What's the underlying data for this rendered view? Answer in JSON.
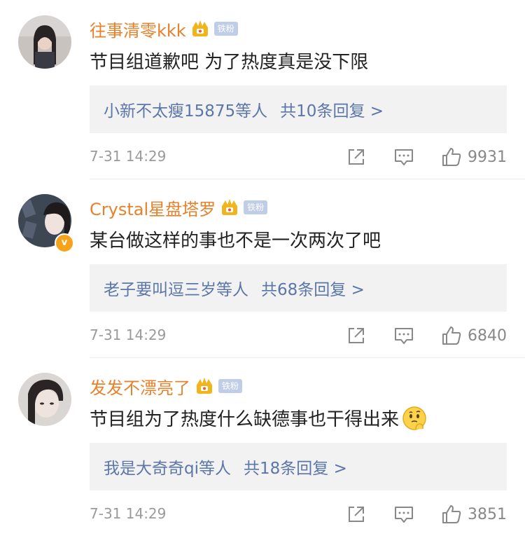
{
  "comments": [
    {
      "username": "往事清零kkk",
      "badge": "铁粉",
      "text": "节目组道歉吧 为了热度真是没下限",
      "reply_user": "小新不太瘦15875",
      "reply_suffix": "等人",
      "reply_count": "共10条回复 >",
      "time": "7-31 14:29",
      "likes": "9931",
      "verified": false
    },
    {
      "username": "Crystal星盘塔罗",
      "badge": "铁粉",
      "text": "某台做这样的事也不是一次两次了吧",
      "reply_user": "老子要叫逗三岁",
      "reply_suffix": "等人",
      "reply_count": "共68条回复 >",
      "time": "7-31 14:29",
      "likes": "6840",
      "verified": true,
      "verified_mark": "v"
    },
    {
      "username": "发发不漂亮了",
      "badge": "铁粉",
      "text": "节目组为了热度什么缺德事也干得出来",
      "reply_user": "我是大奇奇qi",
      "reply_suffix": "等人",
      "reply_count": "共18条回复 >",
      "time": "7-31 14:29",
      "likes": "3851",
      "verified": false,
      "emoji": "thinking-face"
    }
  ],
  "colors": {
    "username": "#e8812b",
    "link": "#5b76a8",
    "meta": "#9a9a9a",
    "reply_bg": "#f2f2f2"
  }
}
